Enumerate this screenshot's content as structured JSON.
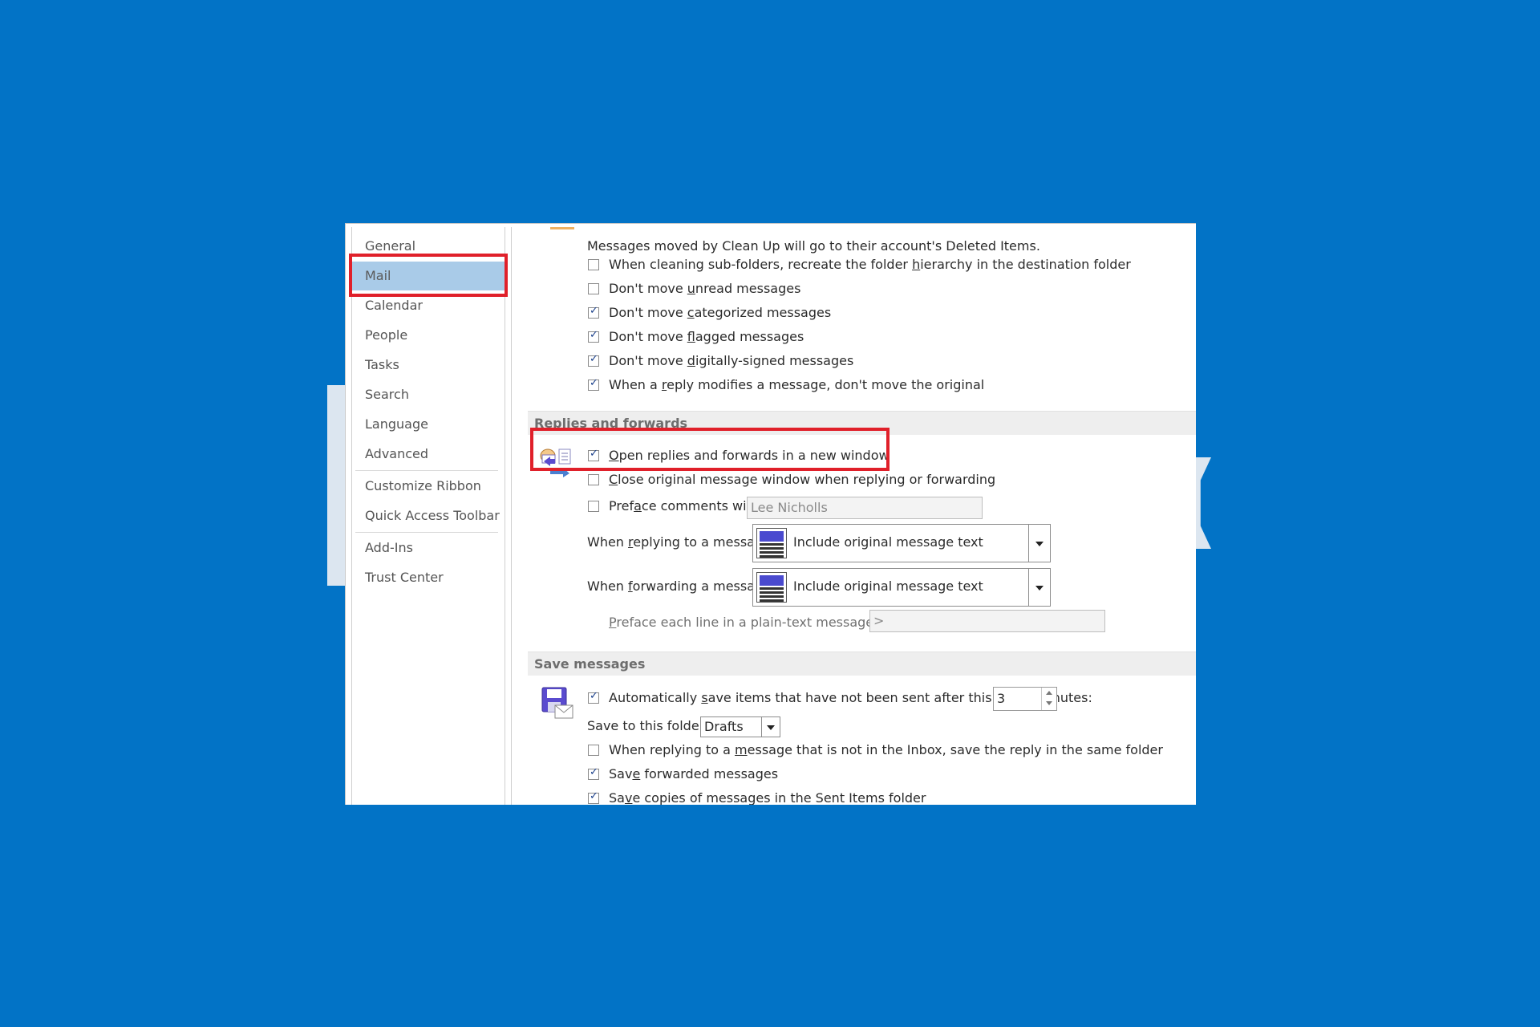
{
  "sidebar": {
    "items": [
      {
        "label": "General"
      },
      {
        "label": "Mail",
        "selected": true
      },
      {
        "label": "Calendar"
      },
      {
        "label": "People"
      },
      {
        "label": "Tasks"
      },
      {
        "label": "Search"
      },
      {
        "label": "Language"
      },
      {
        "label": "Advanced"
      },
      {
        "label": "Customize Ribbon"
      },
      {
        "label": "Quick Access Toolbar"
      },
      {
        "label": "Add-Ins"
      },
      {
        "label": "Trust Center"
      }
    ]
  },
  "cleanup": {
    "note": "Messages moved by Clean Up will go to their account's Deleted Items.",
    "options": [
      {
        "pre": "When cleaning sub-folders, recreate the folder ",
        "key": "h",
        "post": "ierarchy in the destination folder",
        "checked": false
      },
      {
        "pre": "Don't move ",
        "key": "u",
        "post": "nread messages",
        "checked": false
      },
      {
        "pre": "Don't move ",
        "key": "c",
        "post": "ategorized messages",
        "checked": true
      },
      {
        "pre": "Don't move ",
        "key": "f",
        "post": "lagged messages",
        "checked": true
      },
      {
        "pre": "Don't move ",
        "key": "d",
        "post": "igitally-signed messages",
        "checked": true
      },
      {
        "pre": "When a ",
        "key": "r",
        "post": "eply modifies a message, don't move the original",
        "checked": true
      }
    ]
  },
  "replies": {
    "heading": "Replies and forwards",
    "open_new_window": {
      "pre": "",
      "key": "O",
      "post": "pen replies and forwards in a new window",
      "checked": true
    },
    "close_original": {
      "pre": "",
      "key": "C",
      "post": "lose original message window when replying or forwarding",
      "checked": false
    },
    "preface_comments": {
      "pre": "Pref",
      "key": "a",
      "post": "ce comments with:",
      "checked": false,
      "value": "Lee Nicholls"
    },
    "when_replying": {
      "pre": "When ",
      "key": "r",
      "post": "eplying to a message:",
      "value": "Include original message text"
    },
    "when_forwarding": {
      "pre": "When ",
      "key": "f",
      "post": "orwarding a message:",
      "value": "Include original message text"
    },
    "preface_each_line": {
      "pre": "",
      "key": "P",
      "post": "reface each line in a plain-text message with:",
      "value": ">"
    }
  },
  "save": {
    "heading": "Save messages",
    "auto_save": {
      "pre": "Automatically ",
      "key": "s",
      "post": "ave items that have not been sent after this many minutes:",
      "checked": true,
      "minutes": "3"
    },
    "save_to_folder": {
      "label": "Save to this folder:",
      "value": "Drafts"
    },
    "reply_same_folder": {
      "pre": "When replying to a ",
      "key": "m",
      "post": "essage that is not in the Inbox, save the reply in the same folder",
      "checked": false
    },
    "save_forwarded": {
      "pre": "Sav",
      "key": "e",
      "post": " forwarded messages",
      "checked": true
    },
    "save_sent_copies": {
      "pre": "Sa",
      "key": "v",
      "post": "e copies of messages in the Sent Items folder",
      "checked": true
    }
  },
  "colors": {
    "background": "#0273c6",
    "highlight": "#e0202a",
    "selected_nav": "#a9cbe8"
  }
}
